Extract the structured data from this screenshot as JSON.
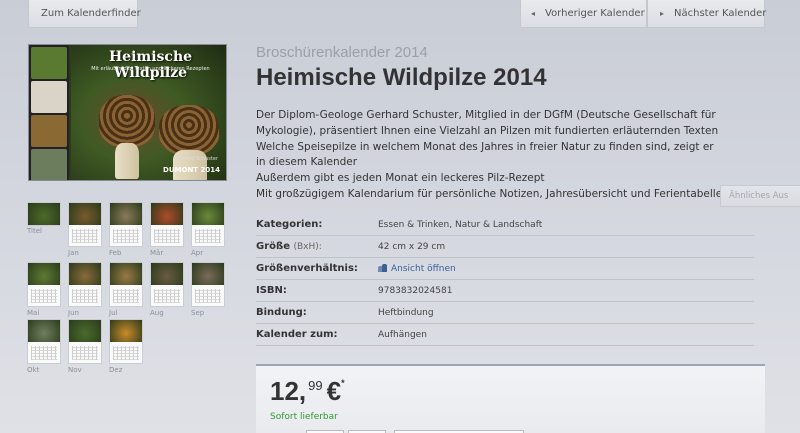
{
  "nav": {
    "finder_label": "Zum Kalenderfinder",
    "prev_label": "Vorheriger Kalender",
    "next_label": "Nächster Kalender"
  },
  "cover": {
    "title": "Heimische Wildpilze",
    "subtitle": "Mit erläuternden Texten und leckeren Rezepten",
    "author": "Gerhard Schuster",
    "brand": "DUMONT 2014"
  },
  "thumbnails": [
    {
      "label": "Titel"
    },
    {
      "label": "Jan"
    },
    {
      "label": "Feb"
    },
    {
      "label": "Mär"
    },
    {
      "label": "Apr"
    },
    {
      "label": "Mai"
    },
    {
      "label": "Jun"
    },
    {
      "label": "Jul"
    },
    {
      "label": "Aug"
    },
    {
      "label": "Sep"
    },
    {
      "label": "Okt"
    },
    {
      "label": "Nov"
    },
    {
      "label": "Dez"
    }
  ],
  "product": {
    "subtitle": "Broschürenkalender 2014",
    "title": "Heimische Wildpilze 2014",
    "description": [
      "Der Diplom-Geologe Gerhard Schuster, Mitglied in der DGfM (Deutsche Gesellschaft für Mykologie), präsentiert Ihnen eine Vielzahl an Pilzen mit fundierten erläuternden Texten",
      "Welche Speisepilze in welchem Monat des Jahres in freier Natur zu finden sind, zeigt er in diesem Kalender",
      "Außerdem gibt es jeden Monat ein leckeres Pilz-Rezept",
      "Mit großzügigem Kalendarium für persönliche Notizen, Jahresübersicht und Ferientabelle"
    ],
    "similar_label": "Ähnliches Aus"
  },
  "specs": {
    "kategorien_label": "Kategorien:",
    "kategorien_value": "Essen & Trinken, Natur & Landschaft",
    "groesse_label": "Größe",
    "groesse_unit": "(BxH):",
    "groesse_value": "42 cm x 29 cm",
    "verhaeltnis_label": "Größenverhältnis:",
    "verhaeltnis_value": "Ansicht öffnen",
    "isbn_label": "ISBN:",
    "isbn_value": "9783832024581",
    "bindung_label": "Bindung:",
    "bindung_value": "Heftbindung",
    "kalender_label": "Kalender zum:",
    "kalender_value": "Aufhängen"
  },
  "price": {
    "euros": "12,",
    "cents": "99",
    "currency": "€",
    "asterisk": "*",
    "availability": "Sofort lieferbar"
  }
}
